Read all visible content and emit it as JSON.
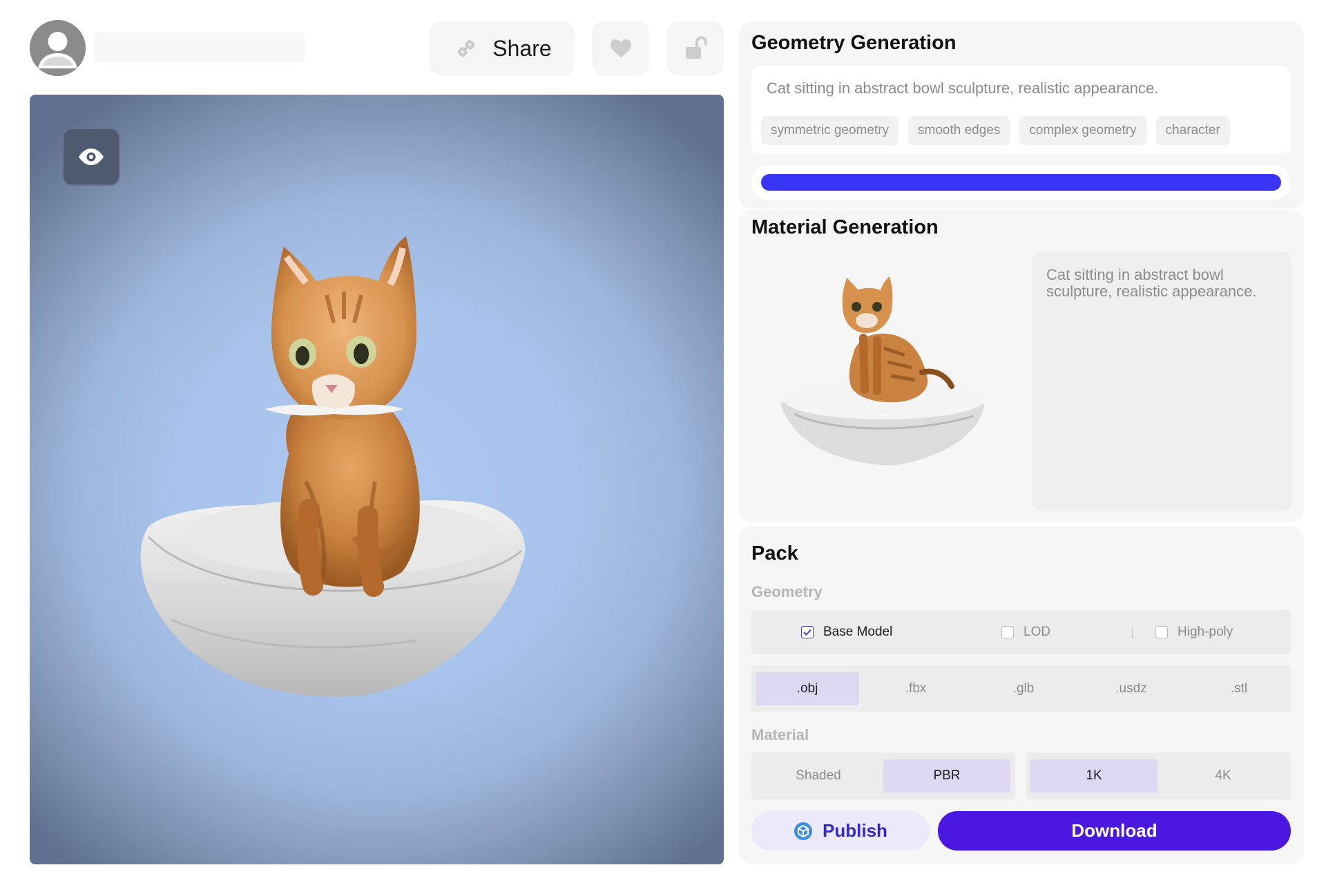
{
  "header": {
    "share_label": "Share",
    "icons": [
      "avatar-icon",
      "link-icon",
      "heart-icon",
      "unlock-icon"
    ]
  },
  "viewer": {
    "eye_icon": "eye-icon",
    "colors": {
      "background": "#a8c3ec",
      "vignette": "#5f7090"
    }
  },
  "geometry": {
    "title": "Geometry Generation",
    "prompt": "Cat sitting in abstract bowl sculpture, realistic appearance.",
    "tags": [
      "symmetric geometry",
      "smooth edges",
      "complex geometry",
      "character"
    ],
    "progress": 1.0
  },
  "material": {
    "title": "Material Generation",
    "description": "Cat sitting in abstract bowl sculpture, realistic appearance."
  },
  "pack": {
    "title": "Pack",
    "geometry_label": "Geometry",
    "geometry_options": [
      {
        "label": "Base Model",
        "checked": true
      },
      {
        "label": "LOD",
        "checked": false
      },
      {
        "label": "High-poly",
        "checked": false
      }
    ],
    "formats": [
      ".obj",
      ".fbx",
      ".glb",
      ".usdz",
      ".stl"
    ],
    "selected_format": ".obj",
    "material_label": "Material",
    "shading_options": [
      "Shaded",
      "PBR"
    ],
    "selected_shading": "PBR",
    "resolution_options": [
      "1K",
      "4K"
    ],
    "selected_resolution": "1K",
    "publish_label": "Publish",
    "download_label": "Download"
  },
  "colors": {
    "accent": "#4a18e0",
    "progress": "#3a35f5",
    "selected_chip": "#ddd7f1",
    "publish_bg": "#ece9fb"
  }
}
